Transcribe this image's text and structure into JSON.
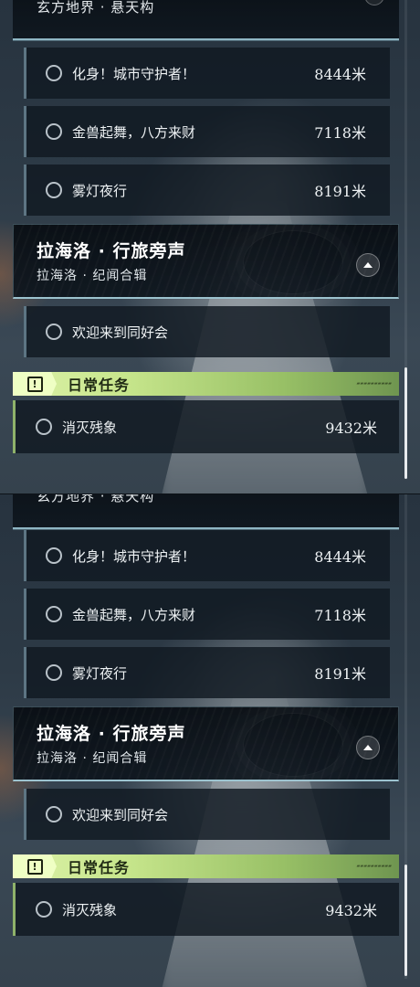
{
  "region_top": {
    "subtitle": "玄方地界 · 悬天构"
  },
  "story_quests": [
    {
      "name": "化身！城市守护者！",
      "distance": "8444米"
    },
    {
      "name": "金兽起舞，八方来财",
      "distance": "7118米"
    },
    {
      "name": "雾灯夜行",
      "distance": "8191米"
    }
  ],
  "region": {
    "title": "拉海洛 · 行旅旁声",
    "subtitle": "拉海洛 · 纪闻合辑",
    "quests": [
      {
        "name": "欢迎来到同好会"
      }
    ]
  },
  "daily": {
    "title": "日常任务",
    "icon_glyph": "!",
    "quests": [
      {
        "name": "消灭残象",
        "distance": "9432米"
      }
    ]
  },
  "colors": {
    "daily_accent": "#c6e58b",
    "region_border": "#9cc3cf",
    "quest_border": "#5d7583"
  }
}
